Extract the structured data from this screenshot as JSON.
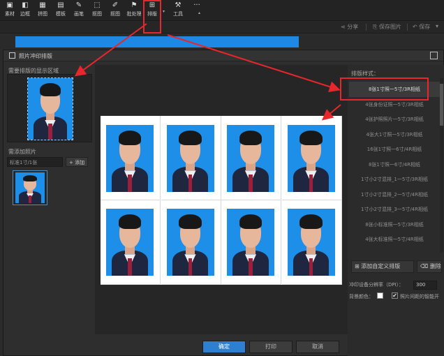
{
  "toolbar": {
    "items": [
      {
        "label": "素材",
        "icon": "folder-icon"
      },
      {
        "label": "边框",
        "icon": "frame-icon"
      },
      {
        "label": "拼图",
        "icon": "collage-icon"
      },
      {
        "label": "模板",
        "icon": "template-icon"
      },
      {
        "label": "画笔",
        "icon": "brush-icon"
      },
      {
        "label": "抠图",
        "icon": "cutout-icon"
      },
      {
        "label": "抠图",
        "icon": "matting-icon"
      },
      {
        "label": "批处理",
        "icon": "batch-icon"
      },
      {
        "label": "排版",
        "icon": "layout-icon"
      },
      {
        "label": "工具",
        "icon": "wrench-icon"
      }
    ],
    "more": "···"
  },
  "bar2": {
    "share": "分享",
    "save_as": "保存图片",
    "save": "保存"
  },
  "dialog": {
    "title": "照片冲印排版",
    "left": {
      "current_label": "需要排版的显示区域",
      "added_label": "需添加照片",
      "size_field": "标准1寸/1张",
      "add_button": "+ 添加"
    },
    "right": {
      "header": "排版样式：",
      "styles": [
        "8张1寸照一5寸/3R相纸",
        "4张身份证照一5寸/3R相纸",
        "4张护照照片一5寸/3R相纸",
        "4张大1寸照一5寸/3R相纸",
        "16张1寸照一6寸/4R相纸",
        "8张1寸照一6寸/4R相纸",
        "1寸小2寸混排_1一5寸/3R相纸",
        "1寸小2寸混排_2一5寸/4R相纸",
        "1寸小2寸混排_3一5寸/4R相纸",
        "8张小标准照一5寸/3R相纸",
        "4张大标准照一5寸/4R相纸"
      ],
      "selected_index": 0,
      "custom_button": "添加自定义排版",
      "delete_button": "删除",
      "dpi_label": "冲印设备分辨率（DPI）：",
      "dpi_value": "300",
      "bg_label": "背景颜色：",
      "reverse_label": "照片间距的智能开"
    },
    "buttons": {
      "ok": "确定",
      "print": "打印",
      "cancel": "取消"
    }
  },
  "colors": {
    "accent": "#1e88e5",
    "highlight": "#e8262b",
    "photo_bg": "#1e8fe8"
  }
}
